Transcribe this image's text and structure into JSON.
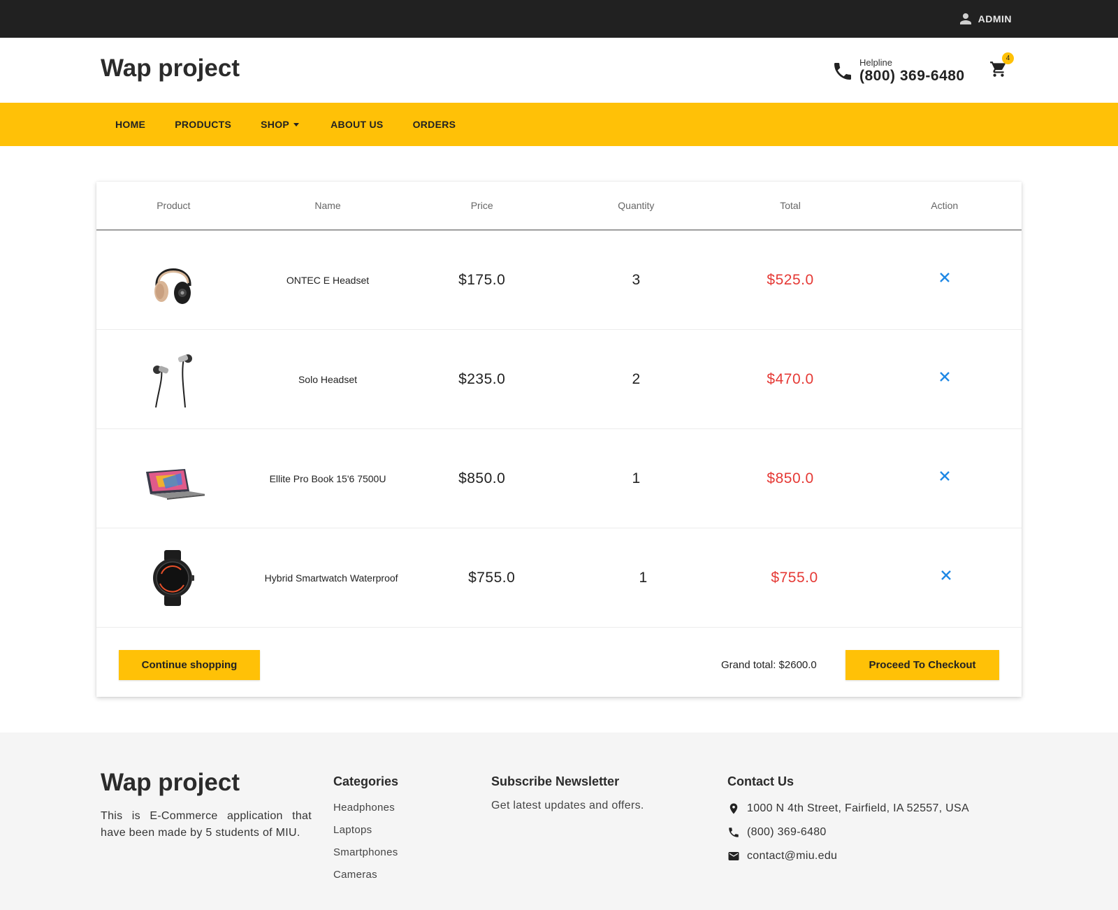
{
  "topbar": {
    "user_label": "ADMIN",
    "user_icon": "person-icon"
  },
  "header": {
    "brand": "Wap project",
    "helpline_label": "Helpline",
    "helpline_phone": "(800) 369-6480",
    "cart_count": "4"
  },
  "nav": {
    "items": [
      {
        "label": "HOME"
      },
      {
        "label": "PRODUCTS"
      },
      {
        "label": "SHOP"
      },
      {
        "label": "ABOUT US"
      },
      {
        "label": "ORDERS"
      }
    ]
  },
  "cart": {
    "columns": [
      "Product",
      "Name",
      "Price",
      "Quantity",
      "Total",
      "Action"
    ],
    "rows": [
      {
        "image": "headphones-image",
        "name": "ONTEC E Headset",
        "price": "$175.0",
        "quantity": "3",
        "total": "$525.0"
      },
      {
        "image": "earphones-image",
        "name": "Solo Headset",
        "price": "$235.0",
        "quantity": "2",
        "total": "$470.0"
      },
      {
        "image": "laptop-image",
        "name": "Ellite Pro Book 15'6 7500U",
        "price": "$850.0",
        "quantity": "1",
        "total": "$850.0"
      },
      {
        "image": "smartwatch-image",
        "name": "Hybrid Smartwatch Waterproof",
        "price": "$755.0",
        "quantity": "1",
        "total": "$755.0"
      }
    ],
    "continue_label": "Continue shopping",
    "grand_total": "Grand total: $2600.0",
    "checkout_label": "Proceed To Checkout"
  },
  "footer": {
    "brand": "Wap project",
    "description": "This is E-Commerce application that have been made by 5 students of MIU.",
    "categories_title": "Categories",
    "categories": [
      "Headphones",
      "Laptops",
      "Smartphones",
      "Cameras"
    ],
    "newsletter_title": "Subscribe Newsletter",
    "newsletter_text": "Get latest updates and offers.",
    "contact_title": "Contact Us",
    "address": "1000 N 4th Street, Fairfield, IA 52557, USA",
    "phone": "(800) 369-6480",
    "email": "contact@miu.edu"
  },
  "colors": {
    "accent": "#ffc107",
    "topbar": "#212121",
    "total_red": "#e53935",
    "remove_blue": "#1e88e5",
    "footer_bg": "#f5f5f5"
  }
}
